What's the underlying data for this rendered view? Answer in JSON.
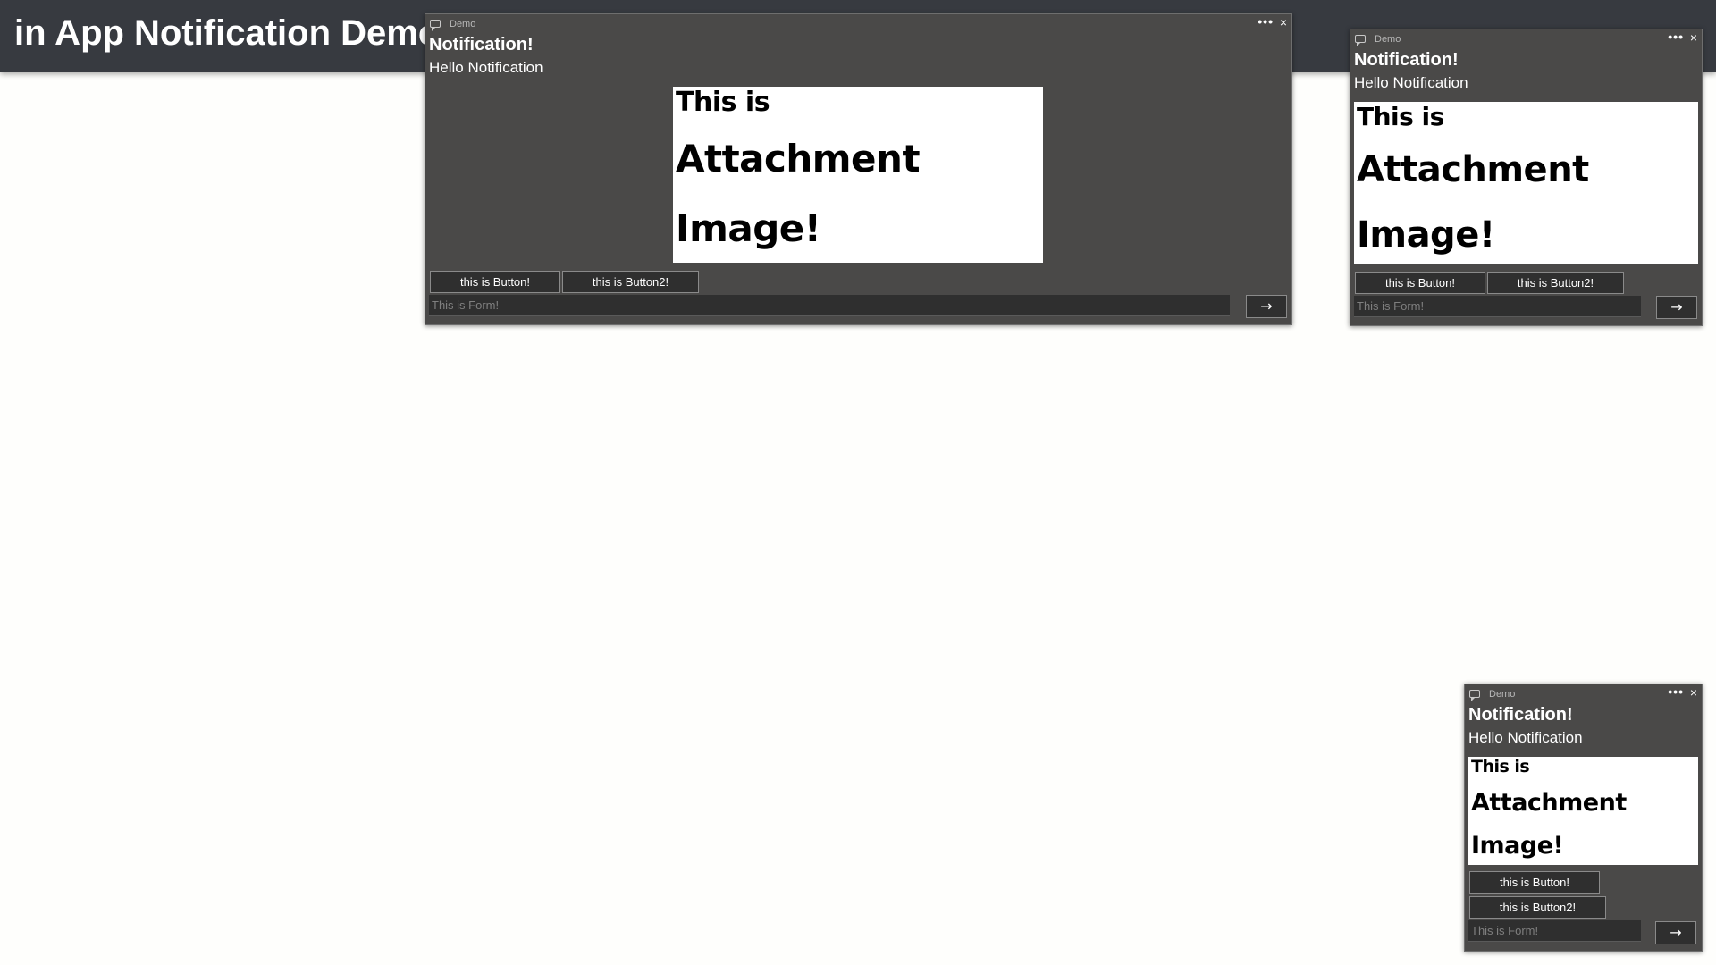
{
  "header": {
    "title": "in App Notification Demo"
  },
  "toast": {
    "app_name": "Demo",
    "more_icon": "more-dots-icon",
    "close_icon": "close-icon",
    "more_glyph": "•••",
    "close_glyph": "×",
    "title": "Notification!",
    "body": "Hello Notification",
    "attachment": {
      "line1": "This is",
      "line2": "Attachment",
      "line3": "Image!"
    },
    "button1": "this is Button!",
    "button2": "this is Button2!",
    "input_placeholder": "This is Form!",
    "send_glyph": "→",
    "send_icon": "arrow-right-icon"
  },
  "colors": {
    "header_bg": "#373a40",
    "toast_bg": "#4a4948",
    "page_bg": "#fefefc",
    "control_bg": "#2f2f2f"
  }
}
